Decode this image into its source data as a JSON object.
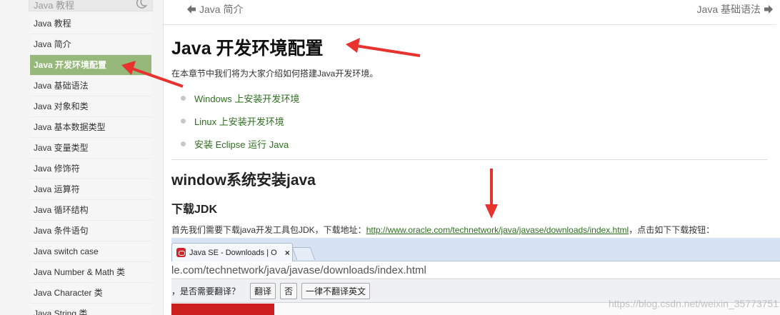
{
  "sidebar": {
    "header": "Java 教程",
    "items": [
      {
        "label": "Java 教程"
      },
      {
        "label": "Java 简介"
      },
      {
        "label": "Java 开发环境配置",
        "active": true
      },
      {
        "label": "Java 基础语法"
      },
      {
        "label": "Java 对象和类"
      },
      {
        "label": "Java 基本数据类型"
      },
      {
        "label": "Java 变量类型"
      },
      {
        "label": "Java 修饰符"
      },
      {
        "label": "Java 运算符"
      },
      {
        "label": "Java 循环结构"
      },
      {
        "label": "Java 条件语句"
      },
      {
        "label": "Java switch case"
      },
      {
        "label": "Java Number & Math 类"
      },
      {
        "label": "Java Character 类"
      },
      {
        "label": "Java String 类"
      }
    ]
  },
  "nav": {
    "prev": "Java 简介",
    "next": "Java 基础语法"
  },
  "article": {
    "title": "Java 开发环境配置",
    "intro": "在本章节中我们将为大家介绍如何搭建Java开发环境。",
    "toc": [
      "Windows 上安装开发环境",
      "Linux 上安装开发环境",
      "安装 Eclipse 运行 Java"
    ],
    "h2": "window系统安装java",
    "h3": "下载JDK",
    "para_before": "首先我们需要下载java开发工具包JDK，下载地址：",
    "para_link": "http://www.oracle.com/technetwork/java/javase/downloads/index.html",
    "para_after": "，点击如下下载按钮："
  },
  "screenshot": {
    "tab_title": "Java SE - Downloads | O",
    "tab_close": "×",
    "address": "le.com/technetwork/java/javase/downloads/index.html",
    "translate_question": "，是否需要翻译？",
    "translate_btn": "翻译",
    "no_btn": "否",
    "never_btn": "一律不翻译英文"
  },
  "watermark": "https://blog.csdn.net/weixin_35773751",
  "colors": {
    "active_item": "#96b97b",
    "link": "#2f6e22",
    "arrow": "#e8322e"
  }
}
